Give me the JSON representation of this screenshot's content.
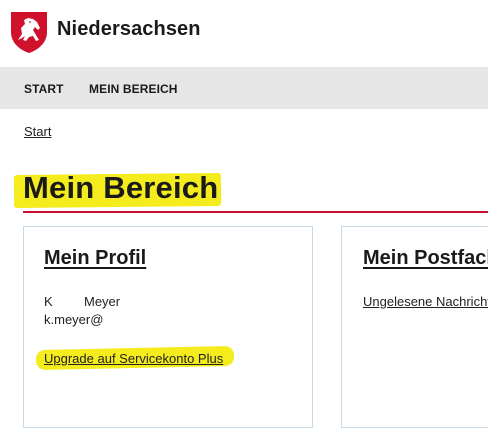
{
  "header": {
    "brand": "Niedersachsen",
    "logo_icon": "niedersachsen-horse-crest-icon"
  },
  "nav": {
    "items": [
      {
        "label": "START"
      },
      {
        "label": "MEIN BEREICH"
      }
    ]
  },
  "breadcrumb": {
    "start": "Start"
  },
  "page": {
    "title": "Mein Bereich"
  },
  "profile": {
    "title": "Mein Profil",
    "first_initial": "K",
    "last_name": "Meyer",
    "email": "k.meyer@",
    "upgrade_link": "Upgrade auf Servicekonto Plus"
  },
  "postfach": {
    "title": "Mein Postfach",
    "unread_link": "Ungelesene Nachrichten"
  },
  "colors": {
    "accent_red": "#c8102e",
    "highlight_yellow": "#f4ec1c",
    "nav_bg": "#e6e6e6",
    "card_border": "#c9dbe6"
  }
}
